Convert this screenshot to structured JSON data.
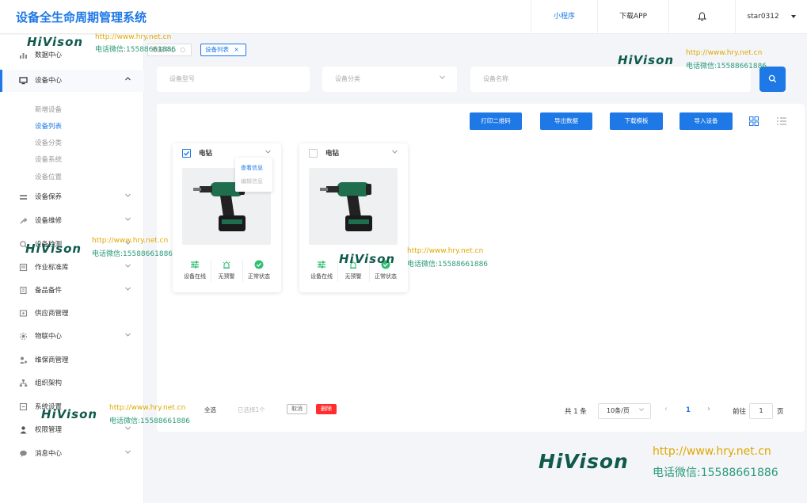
{
  "header": {
    "app_title": "设备全生命周期管理系统",
    "mini_program": "小程序",
    "download_app": "下载APP",
    "user": "star0312"
  },
  "sidebar": {
    "items": [
      {
        "label": "数据中心",
        "icon": "chart-icon"
      },
      {
        "label": "设备中心",
        "icon": "monitor-icon",
        "expanded": true
      },
      {
        "label": "设备保养",
        "icon": "maintain-icon"
      },
      {
        "label": "设备维修",
        "icon": "repair-icon"
      },
      {
        "label": "设备检测",
        "icon": "inspect-icon"
      },
      {
        "label": "作业标准库",
        "icon": "book-icon"
      },
      {
        "label": "备品备件",
        "icon": "parts-icon"
      },
      {
        "label": "供应商管理",
        "icon": "supplier-icon"
      },
      {
        "label": "物联中心",
        "icon": "iot-icon"
      },
      {
        "label": "维保商管理",
        "icon": "service-icon"
      },
      {
        "label": "组织架构",
        "icon": "org-icon"
      },
      {
        "label": "系统设置",
        "icon": "settings-icon"
      },
      {
        "label": "权限管理",
        "icon": "user-icon"
      },
      {
        "label": "消息中心",
        "icon": "message-icon"
      }
    ],
    "submenu": [
      "新增设备",
      "设备列表",
      "设备分类",
      "设备系统",
      "设备位置"
    ]
  },
  "tabs": {
    "prev": "数据中心",
    "active": "设备列表"
  },
  "filters": {
    "model_placeholder": "设备型号",
    "category_placeholder": "设备分类",
    "name_placeholder": "设备名称"
  },
  "actions": {
    "print_qr": "打印二维码",
    "export": "导出数据",
    "download_template": "下载模板",
    "import": "导入设备"
  },
  "cards": [
    {
      "title": "电钻",
      "checked": true,
      "stats": [
        "设备在线",
        "无预警",
        "正常状态"
      ]
    },
    {
      "title": "电钻",
      "checked": false,
      "stats": [
        "设备在线",
        "无预警",
        "正常状态"
      ]
    }
  ],
  "card_menu": {
    "view": "查看信息",
    "edit": "编辑信息"
  },
  "bulk": {
    "select_all": "全选",
    "selected": "已选择1个",
    "cancel": "取消",
    "delete": "删除"
  },
  "pagination": {
    "total": "共 1 条",
    "page_size": "10条/页",
    "current": "1",
    "goto": "前往",
    "goto_value": "1",
    "page_suffix": "页"
  },
  "watermark": {
    "logo": "HiVison",
    "url": "http://www.hry.net.cn",
    "tel": "电话微信:15588661886"
  },
  "colors": {
    "accent": "#1e78e6",
    "danger": "#ff2d2d",
    "success": "#2fbf71"
  }
}
